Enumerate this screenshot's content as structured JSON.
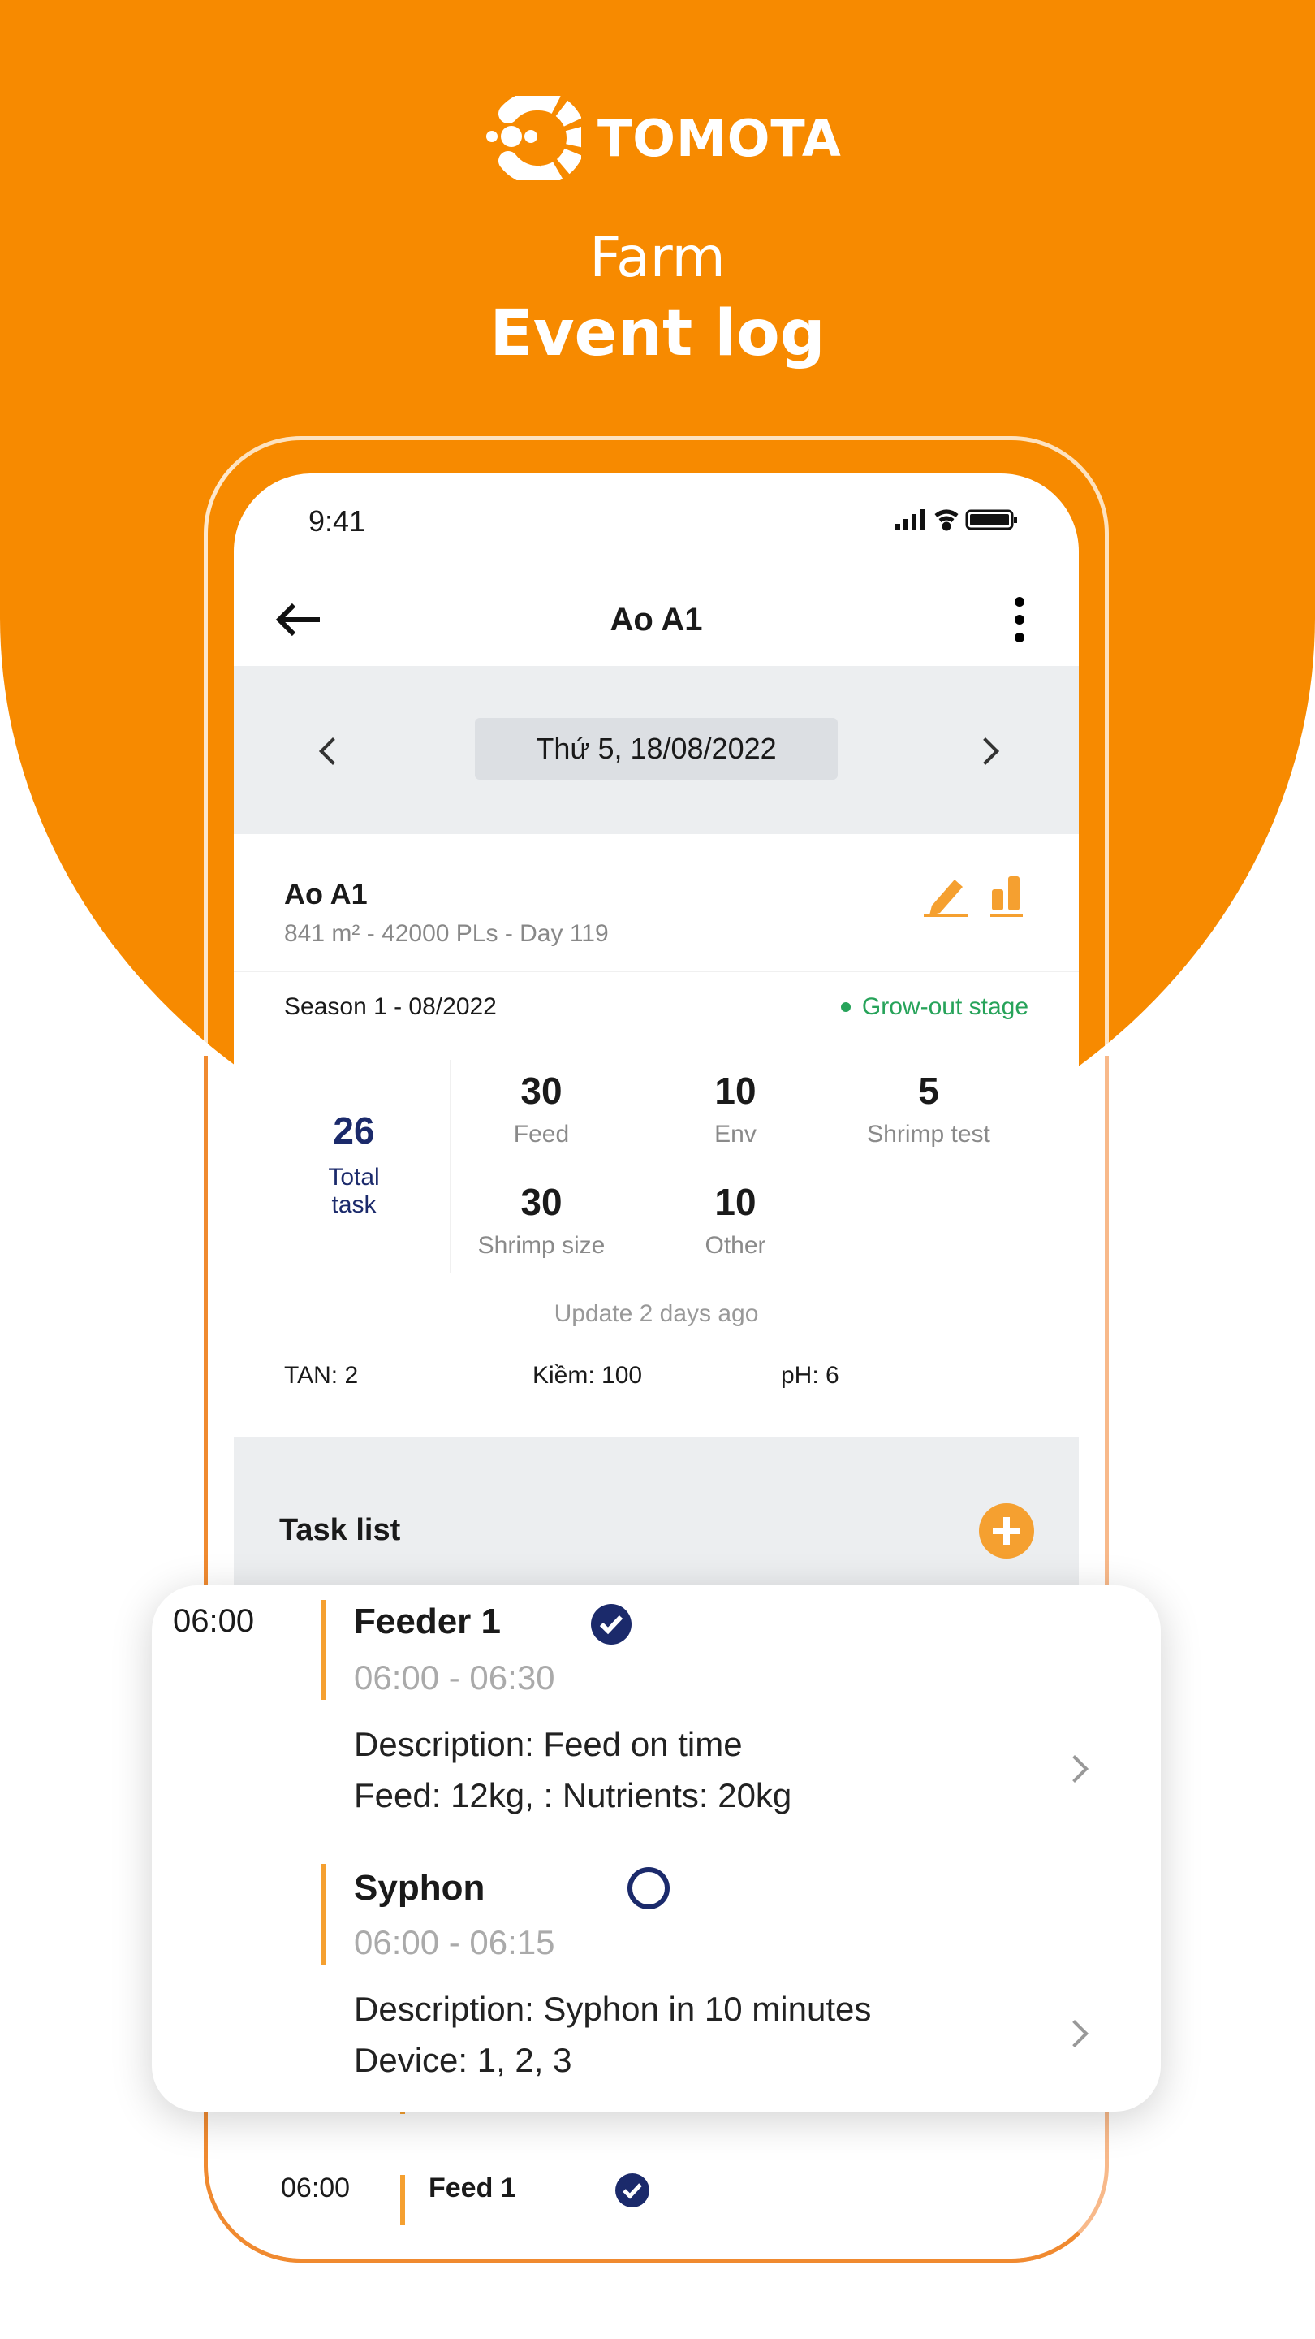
{
  "brand": {
    "name": "TOMOTA",
    "headline_1": "Farm",
    "headline_2": "Event log",
    "color": "#F78A00"
  },
  "status_bar": {
    "time": "9:41"
  },
  "header": {
    "title": "Ao A1"
  },
  "date_nav": {
    "date": "Thứ 5, 18/08/2022"
  },
  "pond": {
    "name": "Ao A1",
    "details": "841 m² - 42000 PLs - Day 119",
    "season": "Season 1 - 08/2022",
    "stage": "Grow-out stage",
    "stage_color": "#27a35a"
  },
  "stats": {
    "total": "26",
    "total_label_1": "Total",
    "total_label_2": "task",
    "items": [
      {
        "value": "30",
        "label": "Feed"
      },
      {
        "value": "10",
        "label": "Env"
      },
      {
        "value": "5",
        "label": "Shrimp test"
      },
      {
        "value": "30",
        "label": "Shrimp size"
      },
      {
        "value": "10",
        "label": "Other"
      }
    ],
    "updated": "Update 2 days ago"
  },
  "params": {
    "tan": "TAN: 2",
    "kiem": "Kiềm: 100",
    "ph": "pH: 6"
  },
  "task_list": {
    "title": "Task list"
  },
  "tasks": [
    {
      "time": "06:00",
      "title": "Feeder 1",
      "range": "06:00 - 06:30",
      "desc": "Description: Feed on time",
      "detail": "Feed: 12kg, : Nutrients: 20kg",
      "done": true
    },
    {
      "title": "Syphon",
      "range": "06:00 - 06:15",
      "desc": "Description: Syphon in 10 minutes",
      "detail": "Device: 1, 2, 3",
      "done": false
    }
  ],
  "background_task": {
    "time": "06:00",
    "title": "Feed 1",
    "done": true
  },
  "accent_navy": "#1b2a6b"
}
